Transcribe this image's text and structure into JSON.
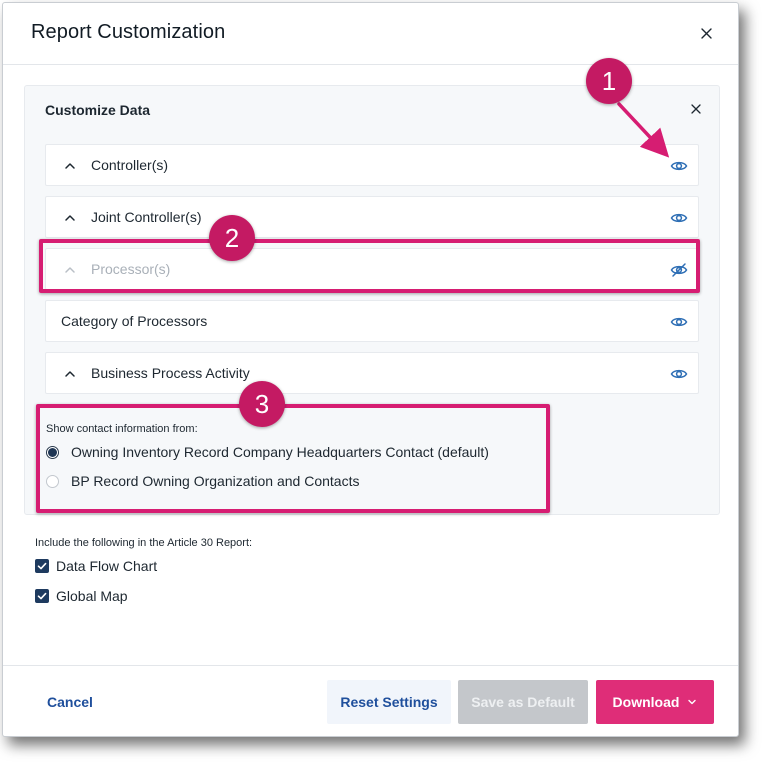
{
  "modal": {
    "title": "Report Customization"
  },
  "panel": {
    "title": "Customize Data",
    "rows": [
      {
        "label": "Controller(s)",
        "has_chevron": true,
        "visible": true
      },
      {
        "label": "Joint Controller(s)",
        "has_chevron": true,
        "visible": true
      },
      {
        "label": "Processor(s)",
        "has_chevron": true,
        "visible": false
      },
      {
        "label": "Category of Processors",
        "has_chevron": false,
        "visible": true
      },
      {
        "label": "Business Process Activity",
        "has_chevron": true,
        "visible": true
      }
    ],
    "contact": {
      "label": "Show contact information from:",
      "options": [
        {
          "label": "Owning Inventory Record Company Headquarters Contact (default)",
          "selected": true
        },
        {
          "label": "BP Record Owning Organization and Contacts",
          "selected": false
        }
      ]
    }
  },
  "include": {
    "label": "Include the following in the Article 30 Report:",
    "items": [
      {
        "label": "Data Flow Chart",
        "checked": true
      },
      {
        "label": "Global Map",
        "checked": true
      }
    ]
  },
  "annotations": {
    "badges": [
      "1",
      "2",
      "3"
    ]
  },
  "footer": {
    "cancel": "Cancel",
    "reset": "Reset Settings",
    "save_default": "Save as Default",
    "download": "Download"
  },
  "colors": {
    "accent_pink": "#df2d78",
    "annotation_pink": "#d61d72",
    "badge_pink": "#c41a63",
    "link_blue": "#1f4f9c",
    "eye_blue": "#2f6fb5",
    "checkbox_navy": "#1e3a5f",
    "disabled_gray": "#c4c7cb"
  }
}
